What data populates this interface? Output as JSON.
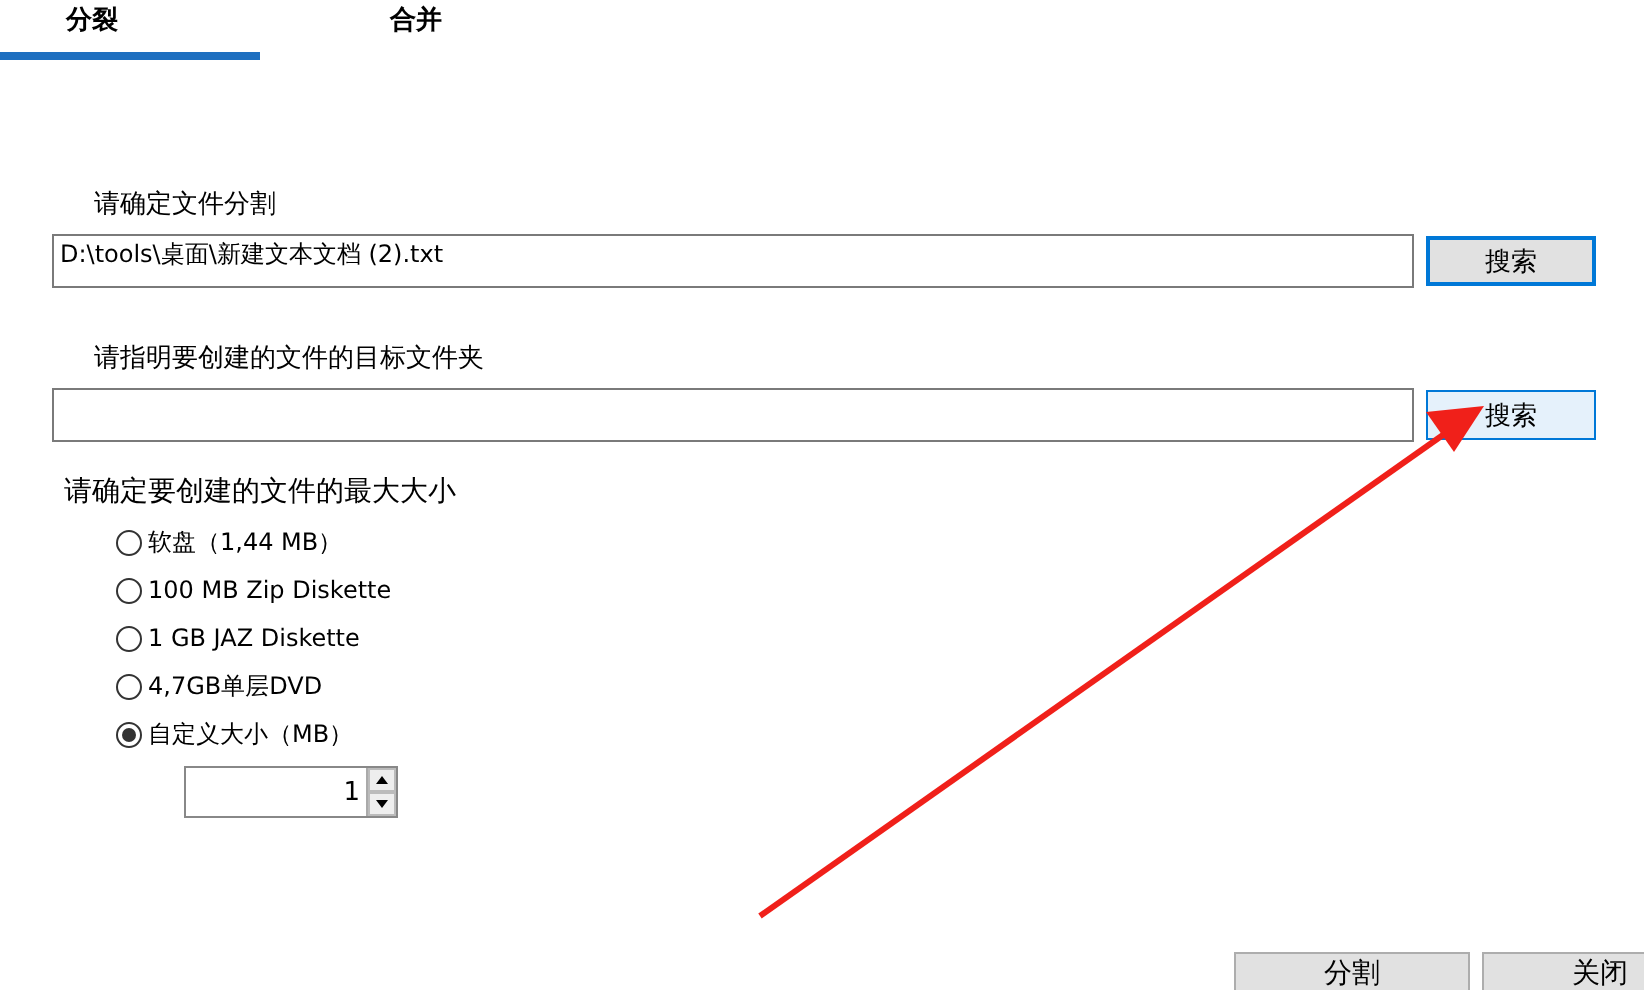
{
  "tabs": [
    {
      "label": "分裂",
      "selected": true
    },
    {
      "label": "合并",
      "selected": false
    }
  ],
  "source": {
    "label": "请确定文件分割",
    "value": "D:\\tools\\桌面\\新建文本文档 (2).txt",
    "button": {
      "label": "搜索",
      "focused": true,
      "hovered": false
    }
  },
  "target": {
    "label": "请指明要创建的文件的目标文件夹",
    "button": {
      "label": "搜索",
      "focused": false,
      "hovered": true
    }
  },
  "size": {
    "label": "请确定要创建的文件的最大大小",
    "options": [
      {
        "label": "软盘（1,44 MB）",
        "selected": false
      },
      {
        "label": "100 MB Zip Diskette",
        "selected": false
      },
      {
        "label": "1 GB JAZ Diskette",
        "selected": false
      },
      {
        "label": "4,7GB单层DVD",
        "selected": false
      },
      {
        "label": "自定义大小（MB）",
        "selected": true
      }
    ],
    "custom_value": "1"
  },
  "buttons": [
    "分割",
    "关闭"
  ]
}
